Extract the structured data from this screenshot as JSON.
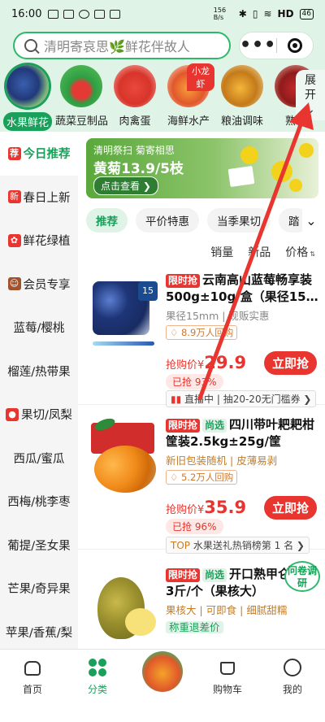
{
  "status": {
    "time": "16:00",
    "net": "156 B/s",
    "signal": "HD",
    "battery": "46"
  },
  "search": {
    "placeholder": "清明寄哀思🌿鲜花伴故人"
  },
  "categories": [
    {
      "label": "水果鲜花",
      "active": true
    },
    {
      "label": "蔬菜豆制品"
    },
    {
      "label": "肉禽蛋"
    },
    {
      "label": "海鲜水产",
      "badge": "小龙虾"
    },
    {
      "label": "粮油调味"
    },
    {
      "label": "熟食"
    }
  ],
  "expand": {
    "line1": "展",
    "line2": "开"
  },
  "sidebar": [
    {
      "label": "今日推荐",
      "tag": "荐",
      "tagColor": "#e8352f",
      "active": true
    },
    {
      "label": "春日上新",
      "tag": "新",
      "tagColor": "#e8352f"
    },
    {
      "label": "鲜花绿植",
      "tag": "✿",
      "tagColor": "#e8352f"
    },
    {
      "label": "会员专享",
      "tag": "☺",
      "tagColor": "#a0522d"
    },
    {
      "label": "蓝莓/樱桃"
    },
    {
      "label": "榴莲/热带果"
    },
    {
      "label": "果切/凤梨",
      "tag": "●",
      "tagColor": "#e8352f"
    },
    {
      "label": "西瓜/蜜瓜"
    },
    {
      "label": "西梅/桃李枣"
    },
    {
      "label": "葡提/圣女果"
    },
    {
      "label": "芒果/奇异果"
    },
    {
      "label": "苹果/香蕉/梨"
    }
  ],
  "banner": {
    "line1": "清明祭扫 菊寄相思",
    "line2": "黄菊13.9/5枝",
    "cta": "点击查看 ❯"
  },
  "tabs": [
    "推荐",
    "平价特惠",
    "当季果切",
    "踏"
  ],
  "sorts": [
    "销量",
    "新品",
    "价格"
  ],
  "products": [
    {
      "tags": [
        "限时抢"
      ],
      "title": "云南高山蓝莓畅享装500g±10g/盒（果径15…",
      "desc": "果径15mm | 现贩实惠",
      "rebuy": "8.9万人回购",
      "price_label": "抢购价¥",
      "price": "29.9",
      "sold": "已抢 93%",
      "buy": "立即抢",
      "live": "直播中 | 抽20-20无门槛券 ❯",
      "img_badge": "15"
    },
    {
      "tags": [
        "限时抢",
        "尚选"
      ],
      "title": "四川带叶耙耙柑筐装2.5kg±25g/筐",
      "desc": "新旧包装随机 | 皮薄易剥",
      "rebuy": "5.2万人回购",
      "price_label": "抢购价¥",
      "price": "35.9",
      "sold": "已抢 96%",
      "buy": "立即抢",
      "live": "水果送礼热销榜第 1 名 ❯"
    },
    {
      "tags": [
        "限时抢",
        "尚选"
      ],
      "title": "开口熟甲仑莲约3斤/个（果核大）",
      "desc": "果核大 | 可即食 | 细腻甜糯",
      "desc2": "称重退差价"
    }
  ],
  "survey": "问卷调研",
  "nav": [
    {
      "label": "首页"
    },
    {
      "label": "分类",
      "active": true
    },
    {
      "label": ""
    },
    {
      "label": "购物车"
    },
    {
      "label": "我的"
    }
  ],
  "colors": {
    "brand": "#1aa05a",
    "accent": "#e8352f",
    "arrow": "#e8352f"
  }
}
